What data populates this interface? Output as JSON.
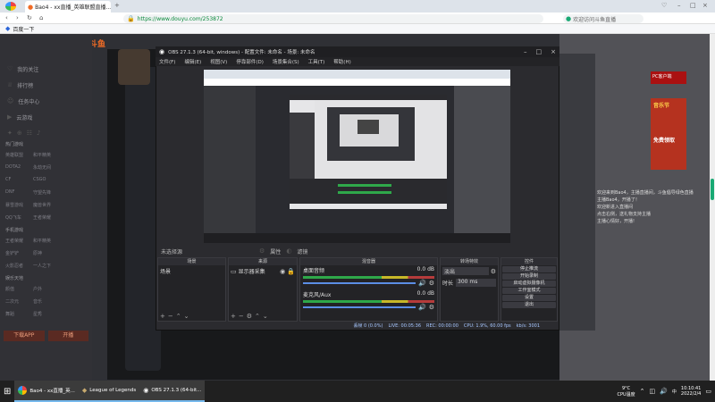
{
  "browser": {
    "tab_title": "Bao4 - xx直播_英雄联盟直播...",
    "url": "https://www.douyu.com/253872",
    "search_text": "欢迎访问斗鱼直播",
    "bookmark": "百度一下"
  },
  "site": {
    "logo": "斗鱼",
    "nav": [
      {
        "icon": "heart-icon",
        "label": "我的关注"
      },
      {
        "icon": "trophy-icon",
        "label": "排行榜"
      },
      {
        "icon": "user-icon",
        "label": "任务中心"
      },
      {
        "icon": "video-icon",
        "label": "云游戏"
      }
    ],
    "section_hot": "热门游戏",
    "hot_games": [
      "英雄联盟",
      "和平精英",
      "DOTA2",
      "永劫无间",
      "CF",
      "CSGO",
      "DNF",
      "守望先锋",
      "暴雪游戏",
      "魔兽世界",
      "QQ飞车",
      "王者荣耀",
      "穿越火线",
      "原神",
      "绝地求生",
      "炉石传说"
    ],
    "section_mobile": "手机游戏",
    "mobile_games": [
      "王者荣耀",
      "和平精英",
      "金铲铲",
      "原神",
      "火影忍者",
      "一人之下"
    ],
    "section_ent": "娱乐天地",
    "ent_items": [
      "颜值",
      "户外",
      "二次元",
      "音乐",
      "舞蹈",
      "星秀"
    ],
    "bottom_buttons": [
      "下载APP",
      "开播"
    ],
    "ad_title": "音乐节",
    "ad_sub": "免费领取",
    "pc_badge": "PC客户端",
    "chat_lines": [
      "欢迎来到Bao4，主播直播间，斗鱼倡导绿色直播",
      "主播Bao4，开播了！",
      "欢迎新进入直播间",
      "点击右侧，送礼物支持主播",
      "主播心情好，开播!"
    ]
  },
  "obs": {
    "title": "OBS 27.1.3 (64-bit, windows) - 配置文件: 未命名 - 场景: 未命名",
    "menu": [
      "文件(F)",
      "编辑(E)",
      "视图(V)",
      "停靠部件(D)",
      "场景集合(S)",
      "工具(T)",
      "帮助(H)"
    ],
    "sub_label": "未选择源",
    "filter_label": "滤镜",
    "props_label": "属性",
    "docks": {
      "scenes": {
        "title": "场景",
        "items": [
          "场景"
        ]
      },
      "sources": {
        "title": "来源",
        "items": [
          "显示器采集"
        ]
      },
      "mixer": {
        "title": "混音器",
        "tracks": [
          {
            "name": "桌面音频",
            "db": "0.0 dB"
          },
          {
            "name": "麦克风/Aux",
            "db": "0.0 dB"
          }
        ]
      },
      "transitions": {
        "title": "转场特效",
        "type": "淡出",
        "duration_label": "时长",
        "duration": "300 ms"
      },
      "controls": {
        "title": "控件",
        "buttons": [
          "停止推流",
          "开始录制",
          "启动虚拟摄像机",
          "工作室模式",
          "设置",
          "退出"
        ]
      }
    },
    "status": {
      "dropped": "丢帧 0 (0.0%)",
      "live": "LIVE: 00:05:36",
      "rec": "REC: 00:00:00",
      "cpu": "CPU: 1.9%, 60.00 fps",
      "kbps": "kb/s: 3001"
    }
  },
  "taskbar": {
    "apps": [
      "Bao4 - xx直播_英...",
      "League of Legends",
      "OBS 27.1.3 (64-bit..."
    ],
    "weather": "9°C",
    "weather_sub": "CPU温度",
    "time": "10:10:41",
    "date": "2022/2/4",
    "lang": "中"
  },
  "colors": {
    "brand": "#f06b25",
    "accent": "#19a974",
    "obs_bg": "#2b2b2f"
  }
}
